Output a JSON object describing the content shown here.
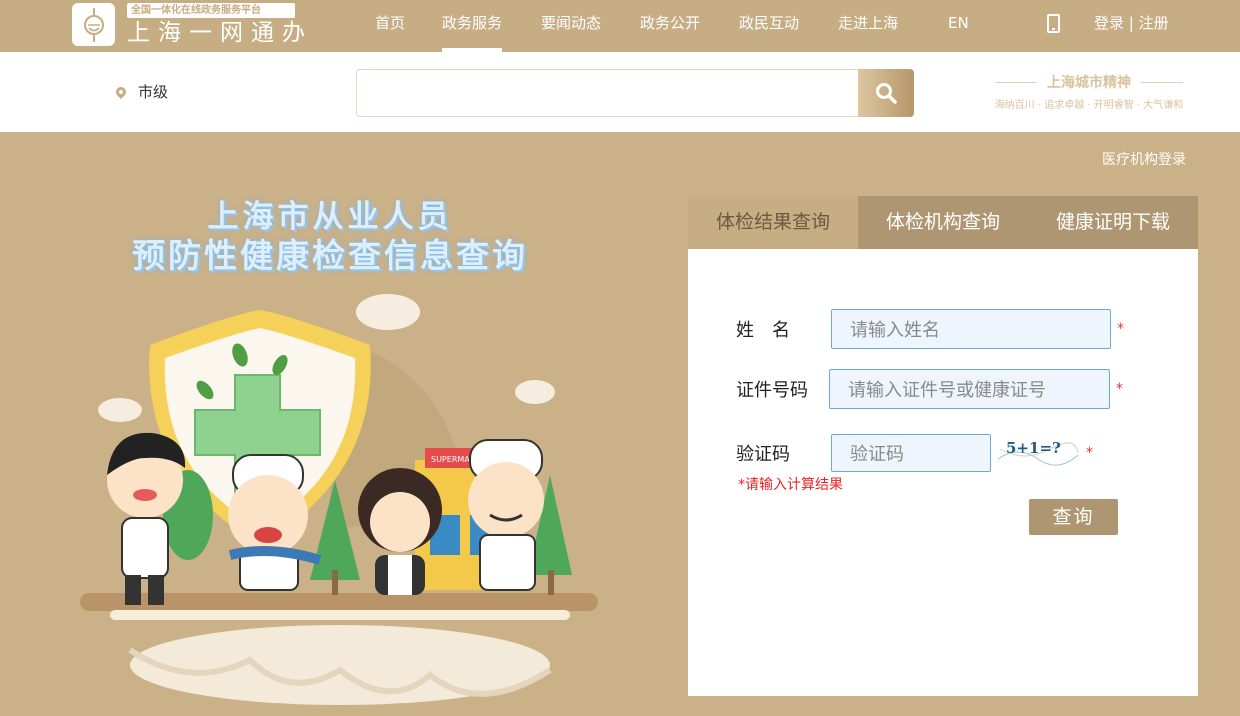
{
  "header": {
    "logo_sub": "全国一体化在线政务服务平台",
    "logo_main": "上海一网通办",
    "nav": [
      "首页",
      "政务服务",
      "要闻动态",
      "政务公开",
      "政民互动",
      "走进上海",
      "EN"
    ],
    "active_nav": "政务服务",
    "auth": "登录 | 注册"
  },
  "search_bar": {
    "location": "市级",
    "search_value": "",
    "spirit_title": "上海城市精神",
    "spirit_sub": "海纳百川 · 追求卓越 · 开明睿智 · 大气谦和"
  },
  "main": {
    "medical_login": "医疗机构登录",
    "hero_line1": "上海市从业人员",
    "hero_line2": "预防性健康检查信息查询",
    "illustration_sign": "SUPERMA"
  },
  "form": {
    "tabs": [
      "体检结果查询",
      "体检机构查询",
      "健康证明下载"
    ],
    "active_tab": "体检结果查询",
    "name_label": "姓　名",
    "name_placeholder": "请输入姓名",
    "id_label": "证件号码",
    "id_placeholder": "请输入证件号或健康证号",
    "captcha_label": "验证码",
    "captcha_placeholder": "验证码",
    "captcha_text": "5+1=?",
    "required_mark": "*",
    "hint": "*请输入计算结果",
    "submit": "查询"
  },
  "colors": {
    "brand": "#c6ad83",
    "tab_bar": "#ad9671",
    "background": "#cbb188",
    "input_border": "#6ea8d6",
    "error": "#e22"
  }
}
